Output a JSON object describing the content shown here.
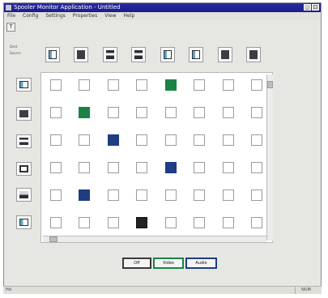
{
  "window": {
    "title": "Spooler Monitor Application - Untitled"
  },
  "menu": [
    "File",
    "Config",
    "Settings",
    "Properties",
    "View",
    "Help"
  ],
  "toolbar": {
    "button_glyph": "T"
  },
  "header_labels": [
    "Dest",
    "Source"
  ],
  "columns": [
    {
      "icon": "wireless-icon",
      "label": ""
    },
    {
      "icon": "network-printer-icon",
      "label": ""
    },
    {
      "icon": "printer-icon",
      "label": ""
    },
    {
      "icon": "printer-icon",
      "label": ""
    },
    {
      "icon": "wireless-icon",
      "label": ""
    },
    {
      "icon": "wireless-icon",
      "label": ""
    },
    {
      "icon": "network-printer-icon",
      "label": ""
    },
    {
      "icon": "network-printer-icon",
      "label": ""
    }
  ],
  "rows": [
    {
      "icon": "camera-icon",
      "label": ""
    },
    {
      "icon": "network-printer-icon",
      "label": ""
    },
    {
      "icon": "printer-icon",
      "label": ""
    },
    {
      "icon": "monitor-icon",
      "label": ""
    },
    {
      "icon": "disk-icon",
      "label": ""
    },
    {
      "icon": "camera-icon",
      "label": ""
    }
  ],
  "matrix": [
    [
      "",
      "",
      "",
      "",
      "green",
      "",
      "",
      ""
    ],
    [
      "",
      "green",
      "",
      "",
      "",
      "",
      "",
      ""
    ],
    [
      "",
      "",
      "blue",
      "",
      "",
      "",
      "",
      ""
    ],
    [
      "",
      "",
      "",
      "",
      "blue",
      "",
      "",
      ""
    ],
    [
      "",
      "blue",
      "",
      "",
      "",
      "",
      "",
      ""
    ],
    [
      "",
      "",
      "",
      "black",
      "",
      "",
      "",
      ""
    ]
  ],
  "colors": {
    "green": "#1b8246",
    "blue": "#1e3d82",
    "black": "#222222"
  },
  "mode_buttons": [
    {
      "label": "Off",
      "color": "#3a3a3a"
    },
    {
      "label": "Video",
      "color": "#1b8246"
    },
    {
      "label": "Audio",
      "color": "#1e3d82"
    }
  ],
  "status": {
    "left": "Hd",
    "right": "NUM"
  }
}
